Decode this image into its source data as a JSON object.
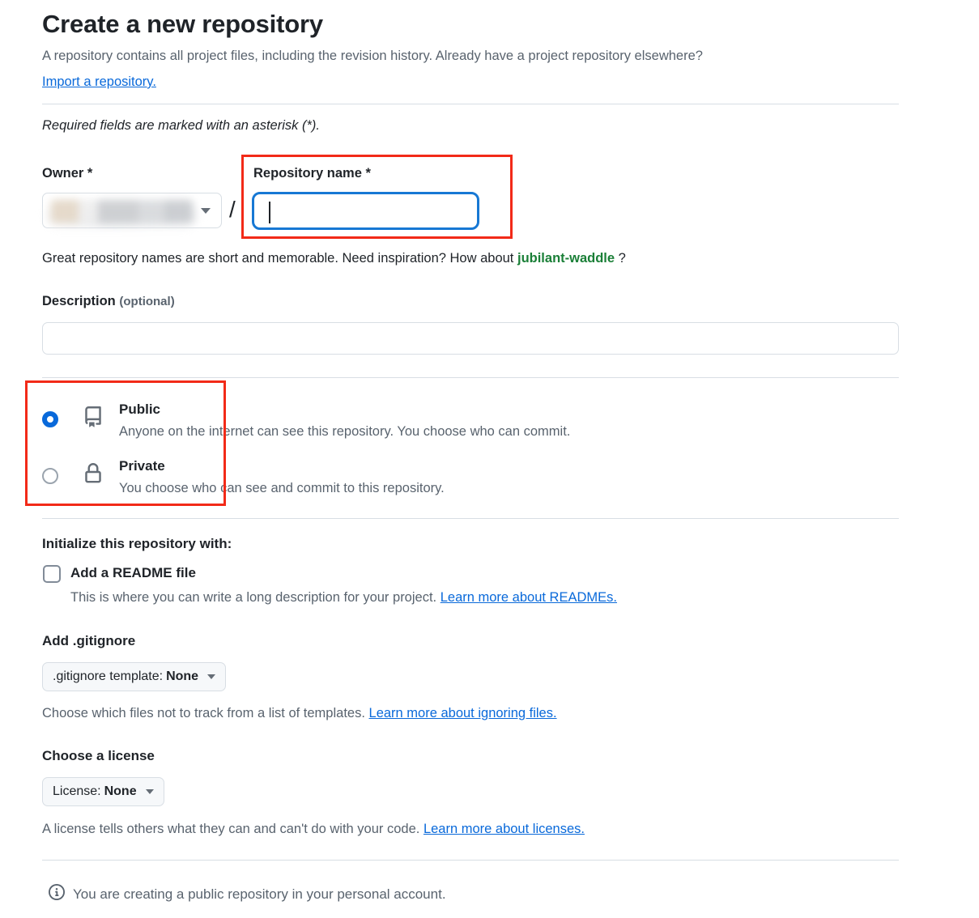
{
  "header": {
    "title": "Create a new repository",
    "subtitle": "A repository contains all project files, including the revision history. Already have a project repository elsewhere?",
    "import_link": "Import a repository."
  },
  "required_note": "Required fields are marked with an asterisk (*).",
  "owner": {
    "label": "Owner *",
    "value": "",
    "redacted": true
  },
  "separator": "/",
  "repo_name": {
    "label": "Repository name *",
    "value": "",
    "focused": true
  },
  "name_hint": {
    "prefix": "Great repository names are short and memorable. Need inspiration? How about",
    "suggestion": "jubilant-waddle",
    "suffix": "?"
  },
  "description": {
    "label": "Description",
    "optional_tag": "(optional)",
    "value": ""
  },
  "visibility": {
    "options": [
      {
        "id": "public",
        "title": "Public",
        "description": "Anyone on the internet can see this repository. You choose who can commit.",
        "icon": "repo-book-icon",
        "selected": true
      },
      {
        "id": "private",
        "title": "Private",
        "description": "You choose who can see and commit to this repository.",
        "icon": "lock-icon",
        "selected": false
      }
    ]
  },
  "initialize": {
    "heading": "Initialize this repository with:",
    "readme": {
      "label": "Add a README file",
      "checked": false,
      "description": "This is where you can write a long description for your project.",
      "link": "Learn more about READMEs."
    }
  },
  "gitignore": {
    "heading": "Add .gitignore",
    "dropdown_prefix": ".gitignore template:",
    "dropdown_value": "None",
    "description": "Choose which files not to track from a list of templates.",
    "link": "Learn more about ignoring files."
  },
  "license": {
    "heading": "Choose a license",
    "dropdown_prefix": "License:",
    "dropdown_value": "None",
    "description": "A license tells others what they can and can't do with your code.",
    "link": "Learn more about licenses."
  },
  "footer": {
    "icon": "info-circle-icon",
    "text": "You are creating a public repository in your personal account."
  },
  "annotations": {
    "color": "#f22a18",
    "boxes": [
      "repository-name-field",
      "visibility-radio-group"
    ]
  },
  "colors": {
    "link": "#0969da",
    "suggestion_green": "#1a7f37",
    "focus_blue": "#1778d4",
    "muted_text": "#59636e",
    "border": "#d8dee4"
  }
}
